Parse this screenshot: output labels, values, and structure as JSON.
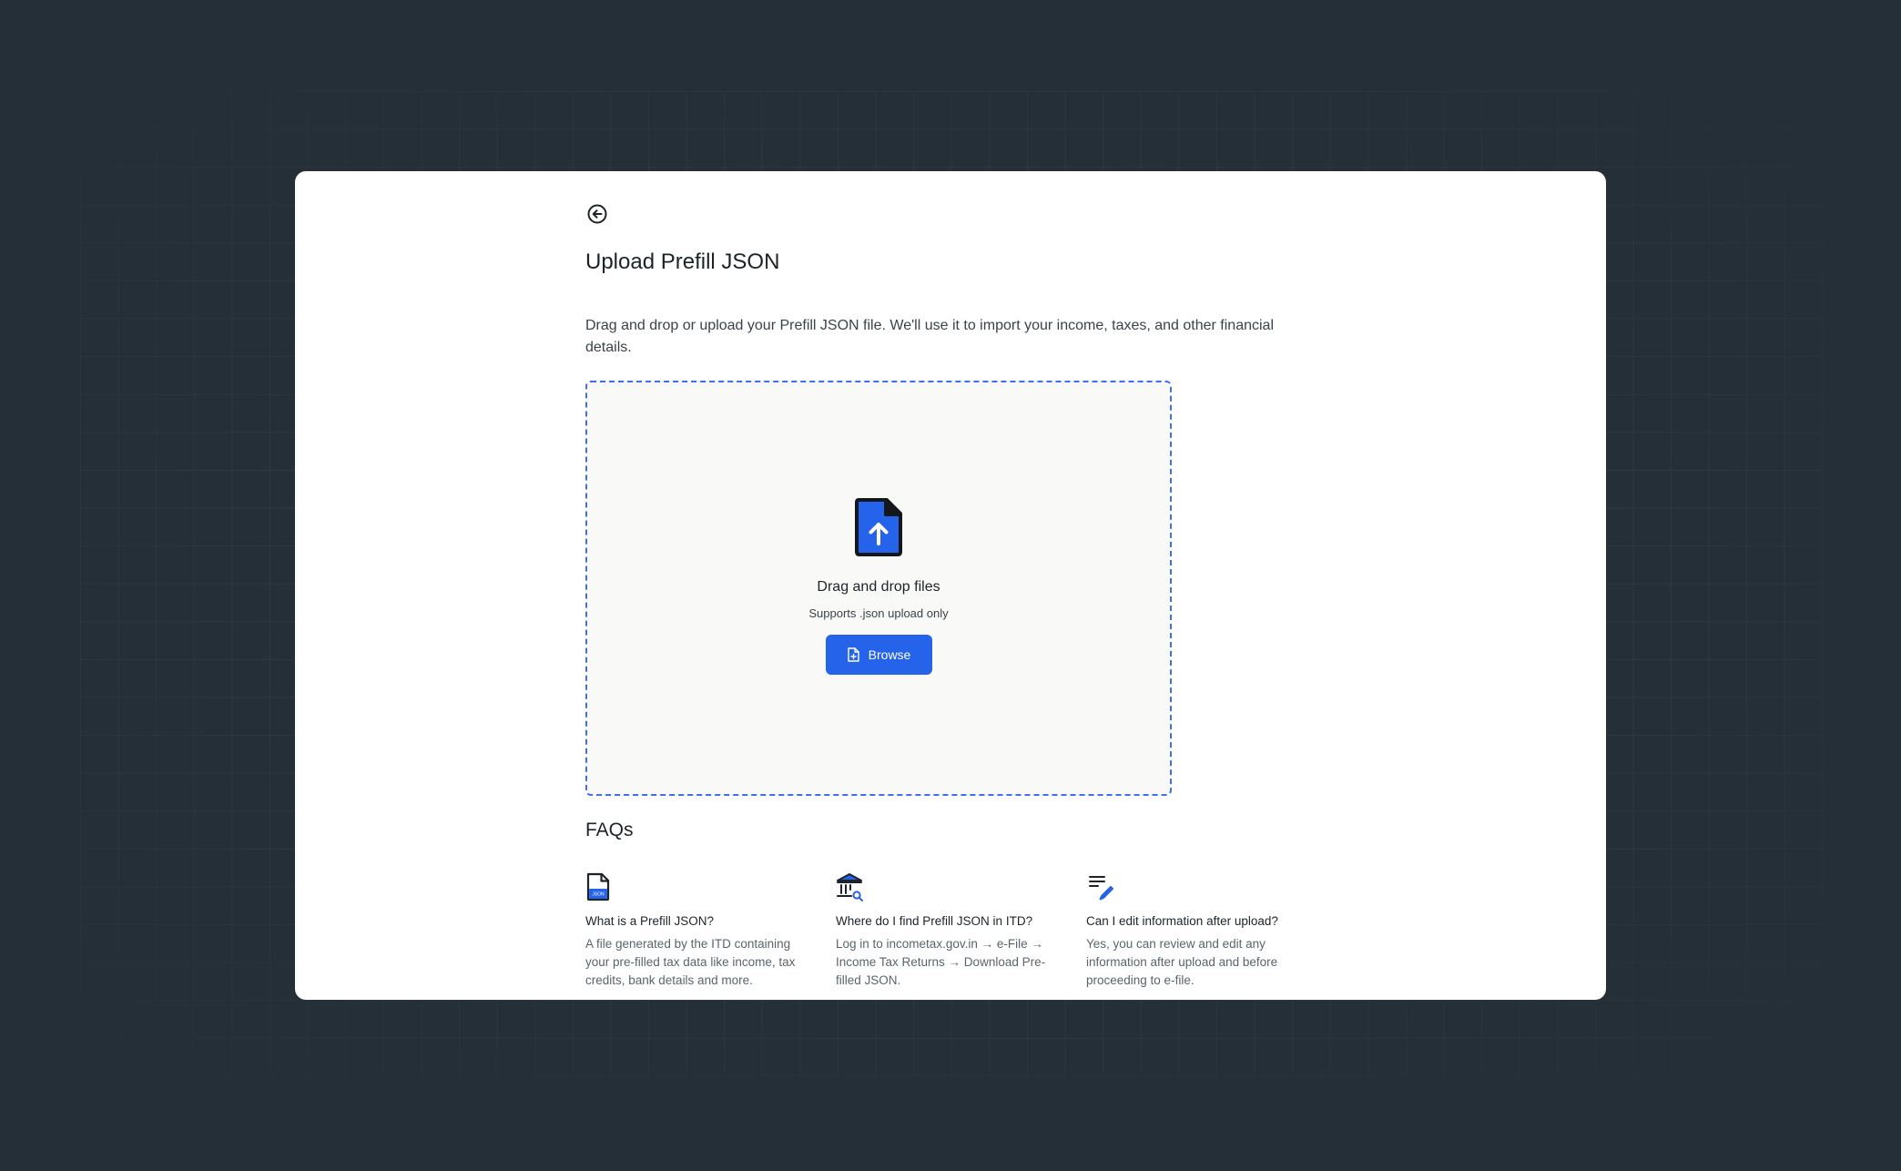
{
  "page": {
    "title": "Upload Prefill JSON",
    "subtitle": "Drag and drop or upload your Prefill JSON file. We'll use it to import your income, taxes, and other financial details."
  },
  "dropzone": {
    "title": "Drag and drop files",
    "hint": "Supports .json upload only",
    "browse_label": "Browse"
  },
  "faqs": {
    "heading": "FAQs",
    "items": [
      {
        "question": "What is a Prefill JSON?",
        "answer": "A file generated by the ITD containing your pre-filled tax data like income, tax credits, bank details and more.",
        "icon": "json-file-icon"
      },
      {
        "question": "Where do I find Prefill JSON in ITD?",
        "answer": "Log in to incometax.gov.in → e-File → Income Tax Returns → Download Pre-filled JSON.",
        "icon": "bank-search-icon"
      },
      {
        "question": "Can I edit information after upload?",
        "answer": "Yes, you can review and edit any information after upload and before proceeding to e-file.",
        "icon": "edit-list-icon"
      }
    ]
  },
  "icons": {
    "json_badge": "JSON"
  },
  "colors": {
    "accent": "#2563eb",
    "background": "#252f37",
    "dropzone_border": "#3e6ef5"
  }
}
